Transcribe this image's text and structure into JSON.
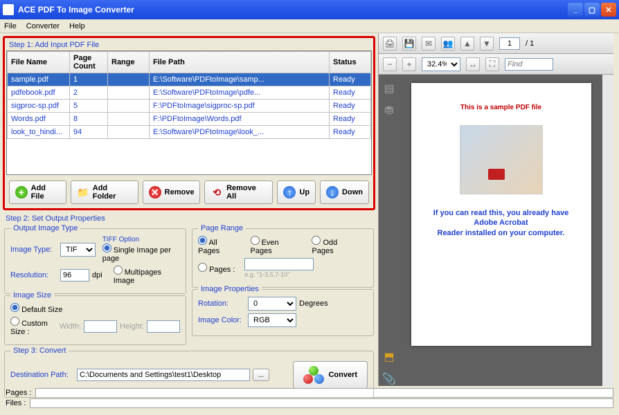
{
  "window_title": "ACE PDF To Image Converter",
  "menu": {
    "file": "File",
    "converter": "Converter",
    "help": "Help"
  },
  "step1": {
    "label": "Step 1: Add Input PDF File",
    "headers": {
      "name": "File Name",
      "count": "Page Count",
      "range": "Range",
      "path": "File Path",
      "status": "Status"
    },
    "rows": [
      {
        "name": "sample.pdf",
        "count": "1",
        "range": "",
        "path": "E:\\Software\\PDFtoImage\\samp...",
        "status": "Ready"
      },
      {
        "name": "pdfebook.pdf",
        "count": "2",
        "range": "",
        "path": "E:\\Software\\PDFtoImage\\pdfe...",
        "status": "Ready"
      },
      {
        "name": "sigproc-sp.pdf",
        "count": "5",
        "range": "",
        "path": "F:\\PDFtoImage\\sigproc-sp.pdf",
        "status": "Ready"
      },
      {
        "name": "Words.pdf",
        "count": "8",
        "range": "",
        "path": "F:\\PDFtoImage\\Words.pdf",
        "status": "Ready"
      },
      {
        "name": "look_to_hindi...",
        "count": "94",
        "range": "",
        "path": "E:\\Software\\PDFtoImage\\look_...",
        "status": "Ready"
      }
    ],
    "buttons": {
      "add_file": "Add File",
      "add_folder": "Add Folder",
      "remove": "Remove",
      "remove_all": "Remove All",
      "up": "Up",
      "down": "Down"
    }
  },
  "step2": {
    "label": "Step 2: Set Output Properties",
    "output_type": {
      "title": "Output Image Type",
      "type_label": "Image Type:",
      "type_value": "TIF",
      "res_label": "Resolution:",
      "res_value": "96",
      "res_unit": "dpi"
    },
    "tiff": {
      "title": "TIFF Option",
      "single": "Single Image per page",
      "multi": "Multipages Image"
    },
    "page_range": {
      "title": "Page Range",
      "all": "All Pages",
      "even": "Even Pages",
      "odd": "Odd Pages",
      "pages_label": "Pages :",
      "placeholder": "e.g. \"1-3,5,7-10\""
    },
    "image_size": {
      "title": "Image Size",
      "default": "Default Size",
      "custom": "Custom Size :",
      "width": "Width:",
      "height": "Height:"
    },
    "image_props": {
      "title": "Image Properties",
      "rotation_label": "Rotation:",
      "rotation_value": "0",
      "rotation_unit": "Degrees",
      "color_label": "Image Color:",
      "color_value": "RGB"
    }
  },
  "step3": {
    "label": "Step 3: Convert",
    "dest_label": "Destination Path:",
    "dest_value": "C:\\Documents and Settings\\test1\\Desktop",
    "convert": "Convert"
  },
  "preview": {
    "page_current": "1",
    "page_total": "/ 1",
    "zoom": "32.4%",
    "find_placeholder": "Find",
    "doc_title": "This is a sample PDF file",
    "doc_footer1": "If you can read this, you already have Adobe Acrobat",
    "doc_footer2": "Reader installed on your computer."
  },
  "footer": {
    "pages": "Pages :",
    "files": "Files :"
  }
}
